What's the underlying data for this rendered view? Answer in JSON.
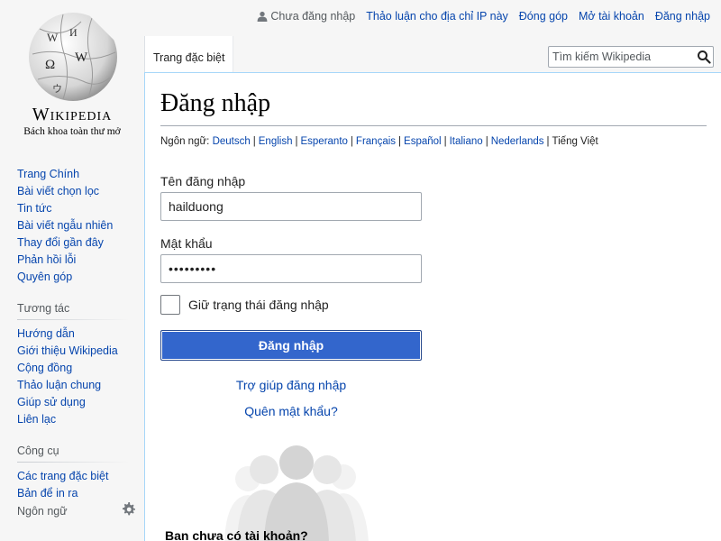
{
  "personal": {
    "anon": "Chưa đăng nhập",
    "talk": "Thảo luận cho địa chỉ IP này",
    "contrib": "Đóng góp",
    "create": "Mở tài khoản",
    "login": "Đăng nhập"
  },
  "logo": {
    "wordmark": "Wikipedia",
    "tagline": "Bách khoa toàn thư mở"
  },
  "tabs": {
    "special": "Trang đặc biệt"
  },
  "search": {
    "placeholder": "Tìm kiếm Wikipedia",
    "icon": "search-icon"
  },
  "sidebar": {
    "main": [
      "Trang Chính",
      "Bài viết chọn lọc",
      "Tin tức",
      "Bài viết ngẫu nhiên",
      "Thay đổi gần đây",
      "Phản hồi lỗi",
      "Quyên góp"
    ],
    "interaction_heading": "Tương tác",
    "interaction": [
      "Hướng dẫn",
      "Giới thiệu Wikipedia",
      "Cộng đồng",
      "Thảo luận chung",
      "Giúp sử dụng",
      "Liên lạc"
    ],
    "tools_heading": "Công cụ",
    "tools": [
      "Các trang đặc biệt",
      "Bản để in ra"
    ],
    "languages_heading": "Ngôn ngữ"
  },
  "page": {
    "title": "Đăng nhập",
    "lang_prefix": "Ngôn ngữ:",
    "languages": [
      "Deutsch",
      "English",
      "Esperanto",
      "Français",
      "Español",
      "Italiano",
      "Nederlands"
    ],
    "current_language": "Tiếng Việt",
    "username_label": "Tên đăng nhập",
    "username_value": "hailduong",
    "password_label": "Mật khẩu",
    "password_value": "•••••••••",
    "remember_label": "Giữ trạng thái đăng nhập",
    "login_button": "Đăng nhập",
    "help_link": "Trợ giúp đăng nhập",
    "forgot_link": "Quên mật khẩu?",
    "create_heading": "Bạn chưa có tài khoản?"
  },
  "colors": {
    "link": "#0645ad",
    "button": "#3366cc",
    "sidebar_bg": "#f6f6f6",
    "border": "#a7d7f9"
  }
}
